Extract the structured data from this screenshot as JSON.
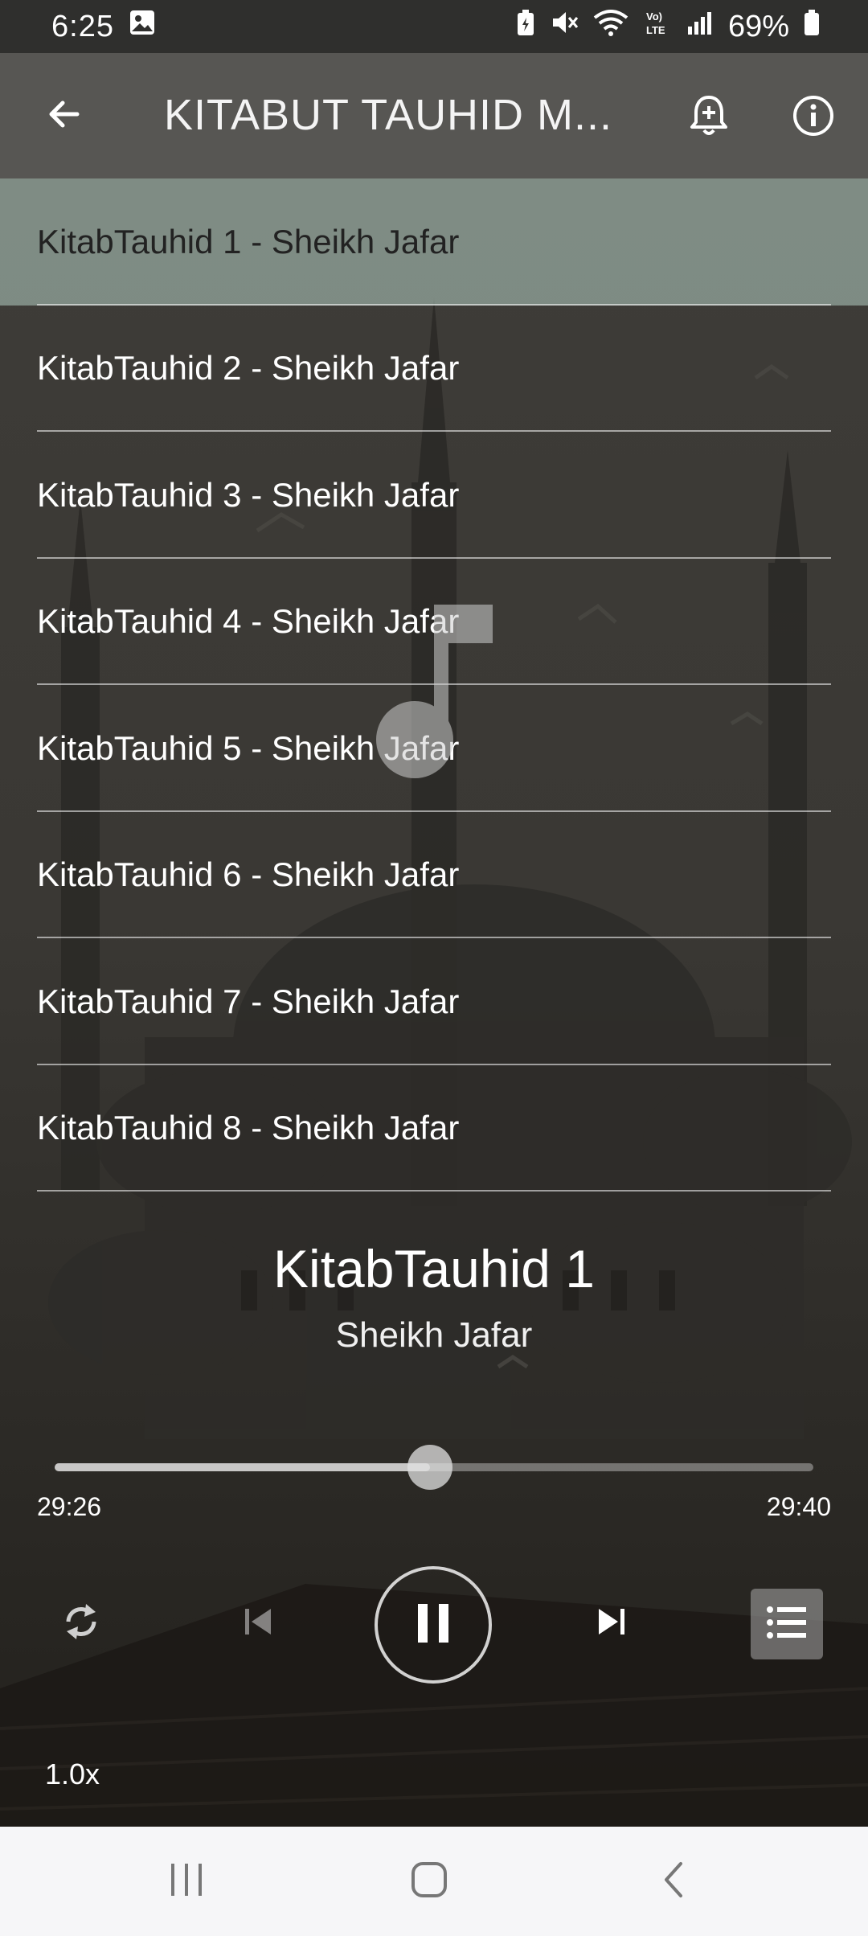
{
  "status_bar": {
    "time": "6:25",
    "battery_text": "69%",
    "icons": [
      "gallery-icon",
      "battery-saver-icon",
      "mute-icon",
      "wifi-icon",
      "volte-icon",
      "signal-icon",
      "battery-icon"
    ]
  },
  "app_bar": {
    "title": "KITABUT TAUHID M...",
    "icons": [
      "back-arrow-icon",
      "add-alarm-icon",
      "info-icon"
    ]
  },
  "playlist": [
    {
      "label": "KitabTauhid 1 - Sheikh Jafar",
      "active": true
    },
    {
      "label": "KitabTauhid 2 - Sheikh Jafar",
      "active": false
    },
    {
      "label": "KitabTauhid 3 - Sheikh Jafar",
      "active": false
    },
    {
      "label": "KitabTauhid 4 - Sheikh Jafar",
      "active": false
    },
    {
      "label": "KitabTauhid 5 - Sheikh Jafar",
      "active": false
    },
    {
      "label": "KitabTauhid 6 - Sheikh Jafar",
      "active": false
    },
    {
      "label": "KitabTauhid 7 - Sheikh Jafar",
      "active": false
    },
    {
      "label": "KitabTauhid 8 - Sheikh Jafar",
      "active": false
    }
  ],
  "now_playing": {
    "title": "KitabTauhid 1",
    "artist": "Sheikh Jafar"
  },
  "progress": {
    "elapsed": "29:26",
    "total": "29:40",
    "fraction": 0.495
  },
  "controls": {
    "speed": "1.0x",
    "icons": [
      "repeat-icon",
      "skip-previous-icon",
      "pause-icon",
      "skip-next-icon",
      "playlist-icon"
    ]
  },
  "colors": {
    "app_bar": "#575653",
    "active_row": "#b4cdc3",
    "nav_bar": "#f6f6f8"
  }
}
